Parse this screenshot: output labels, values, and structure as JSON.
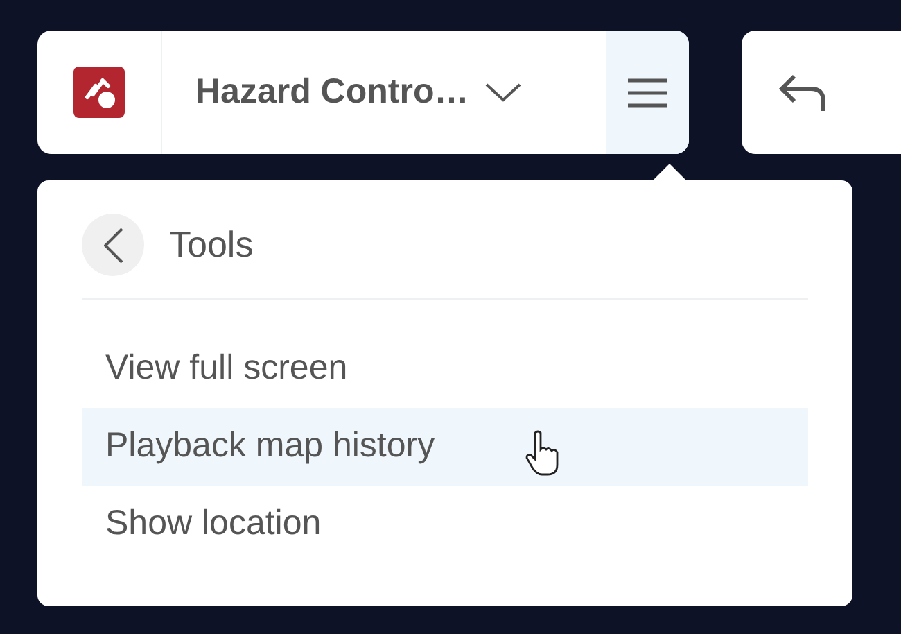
{
  "header": {
    "title": "Hazard Contro…",
    "menu_open": true
  },
  "menu": {
    "title": "Tools",
    "items": [
      {
        "label": "View full screen",
        "highlighted": false
      },
      {
        "label": "Playback map history",
        "highlighted": true
      },
      {
        "label": "Show location",
        "highlighted": false
      }
    ]
  }
}
